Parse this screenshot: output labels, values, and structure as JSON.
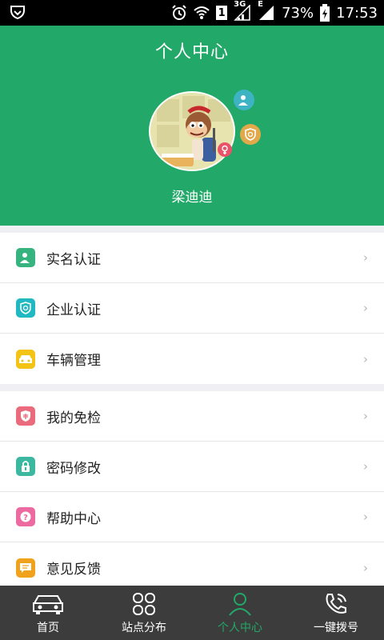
{
  "status_bar": {
    "network": "3G",
    "sim": "1",
    "edge": "E",
    "battery": "73%",
    "time": "17:53"
  },
  "header": {
    "title": "个人中心",
    "username": "梁迪迪"
  },
  "menu_group_1": [
    {
      "label": "实名认证",
      "icon": "id-card-icon",
      "color": "#36b37e"
    },
    {
      "label": "企业认证",
      "icon": "enterprise-icon",
      "color": "#1fb8c3"
    },
    {
      "label": "车辆管理",
      "icon": "car-icon",
      "color": "#f3c316"
    }
  ],
  "menu_group_2": [
    {
      "label": "我的免检",
      "icon": "exempt-icon",
      "color": "#ea6b7b"
    },
    {
      "label": "密码修改",
      "icon": "lock-icon",
      "color": "#3cb8a1"
    },
    {
      "label": "帮助中心",
      "icon": "help-icon",
      "color": "#ec6aa0"
    },
    {
      "label": "意见反馈",
      "icon": "feedback-icon",
      "color": "#f0a21c"
    }
  ],
  "bottom_nav": [
    {
      "label": "首页",
      "icon": "car-icon"
    },
    {
      "label": "站点分布",
      "icon": "clover-icon"
    },
    {
      "label": "个人中心",
      "icon": "person-icon",
      "active": true
    },
    {
      "label": "一键拨号",
      "icon": "phone-icon"
    }
  ],
  "colors": {
    "brand": "#22a868",
    "nav_bg": "#3c3c3c"
  }
}
